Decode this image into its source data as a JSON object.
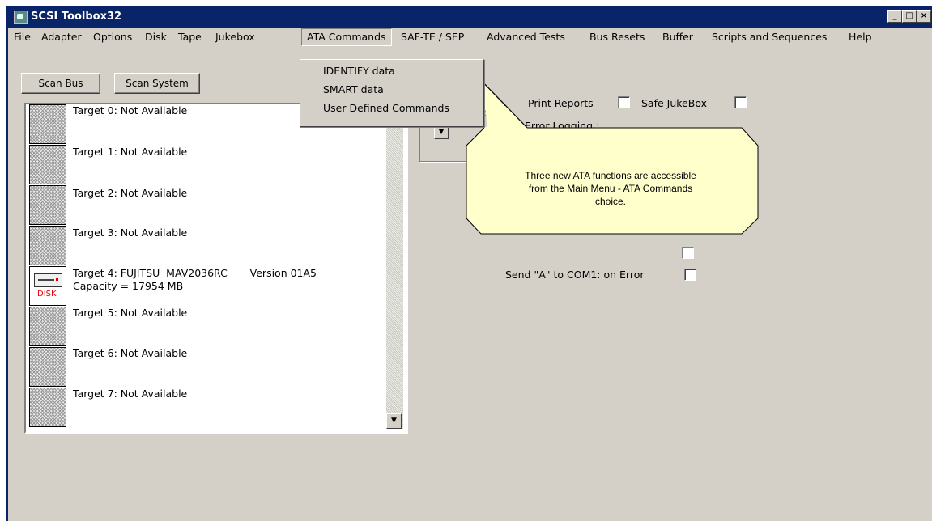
{
  "window": {
    "title": "SCSI Toolbox32",
    "controls": [
      "_",
      "□",
      "×"
    ]
  },
  "menu": [
    {
      "label": "File"
    },
    {
      "label": "Adapter"
    },
    {
      "label": "Options"
    },
    {
      "label": "Disk"
    },
    {
      "label": "Tape"
    },
    {
      "label": "Jukebox"
    },
    {
      "label": "ATA Commands",
      "open": true
    },
    {
      "label": "SAF-TE / SEP"
    },
    {
      "label": "Advanced Tests"
    },
    {
      "label": "Bus Resets"
    },
    {
      "label": "Buffer"
    },
    {
      "label": "Scripts and Sequences"
    },
    {
      "label": "Help"
    }
  ],
  "ata_dropdown": [
    "IDENTIFY data",
    "SMART data",
    "User Defined Commands"
  ],
  "buttons": {
    "scan_bus": "Scan Bus",
    "scan_system": "Scan System"
  },
  "targets": [
    {
      "line1": "Target 0: Not Available",
      "line2": "",
      "icon": "empty-slot"
    },
    {
      "line1": "Target 1: Not Available",
      "line2": "",
      "icon": "empty-slot"
    },
    {
      "line1": "Target 2: Not Available",
      "line2": "",
      "icon": "empty-slot"
    },
    {
      "line1": "Target 3: Not Available",
      "line2": "",
      "icon": "empty-slot"
    },
    {
      "line1": "Target 4: FUJITSU  MAV2036RC       Version 01A5",
      "line2": "Capacity = 17954 MB",
      "icon": "disk",
      "icon_label": "DISK"
    },
    {
      "line1": "Target 5: Not Available",
      "line2": "",
      "icon": "empty-slot"
    },
    {
      "line1": "Target 6: Not Available",
      "line2": "",
      "icon": "empty-slot"
    },
    {
      "line1": "Target 7: Not Available",
      "line2": "",
      "icon": "empty-slot"
    }
  ],
  "options": {
    "print_reports": "Print Reports",
    "safe_jukebox": "Safe JukeBox",
    "error_logging": "Error Logging :",
    "send_a": "Send \"A\" to COM1: on Error"
  },
  "callout": {
    "line1": "Three new ATA functions are accessible",
    "line2": "from the Main Menu - ATA Commands",
    "line3": "choice.",
    "fill": "#ffffcc"
  },
  "colors": {
    "titlebar": "#0a246a",
    "face": "#d4d0c8"
  }
}
